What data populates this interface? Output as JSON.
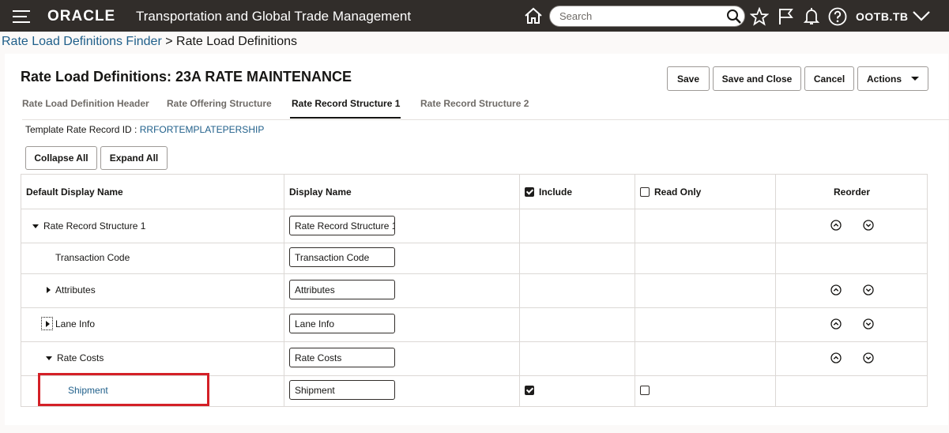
{
  "header": {
    "logo_text": "ORACLE",
    "app_title": "Transportation and Global Trade Management",
    "search_placeholder": "Search",
    "user": "OOTB.TB",
    "icons": [
      "hamburger-icon",
      "home-icon",
      "search-icon",
      "star-icon",
      "flag-icon",
      "bell-icon",
      "help-icon",
      "chevron-down-icon"
    ]
  },
  "breadcrumb": {
    "parent": "Rate Load Definitions Finder",
    "separator": " > ",
    "current": "Rate Load Definitions"
  },
  "page": {
    "title": "Rate Load Definitions: 23A RATE MAINTENANCE",
    "buttons": {
      "save": "Save",
      "save_close": "Save and Close",
      "cancel": "Cancel",
      "actions": "Actions"
    },
    "tabs": [
      "Rate Load Definition Header",
      "Rate Offering Structure",
      "Rate Record Structure 1",
      "Rate Record Structure 2"
    ],
    "active_tab": "Rate Record Structure 1",
    "template_label": "Template Rate Record ID : ",
    "template_value": "RRFORTEMPLATEPERSHIP",
    "toolbar": {
      "collapse_all": "Collapse All",
      "expand_all": "Expand All"
    }
  },
  "table": {
    "columns": {
      "default_display_name": "Default Display Name",
      "display_name": "Display Name",
      "include": "Include",
      "read_only": "Read Only",
      "reorder": "Reorder"
    },
    "include_header_checked": true,
    "read_only_header_checked": false,
    "rows": [
      {
        "default_name": "Rate Record Structure 1",
        "display_name": "Rate Record Structure 1",
        "expander": "expanded"
      },
      {
        "default_name": "Transaction Code",
        "display_name": "Transaction Code",
        "expander": "none"
      },
      {
        "default_name": "Attributes",
        "display_name": "Attributes",
        "expander": "collapsed"
      },
      {
        "default_name": "Lane Info",
        "display_name": "Lane Info",
        "expander": "collapsed-focused"
      },
      {
        "default_name": "Rate Costs",
        "display_name": "Rate Costs",
        "expander": "expanded"
      },
      {
        "default_name": "Shipment",
        "display_name": "Shipment",
        "expander": "none",
        "include": true,
        "read_only": false
      }
    ]
  },
  "colors": {
    "header_bg": "#312d2a",
    "link": "#1f5f8a",
    "highlight": "#d42027"
  }
}
